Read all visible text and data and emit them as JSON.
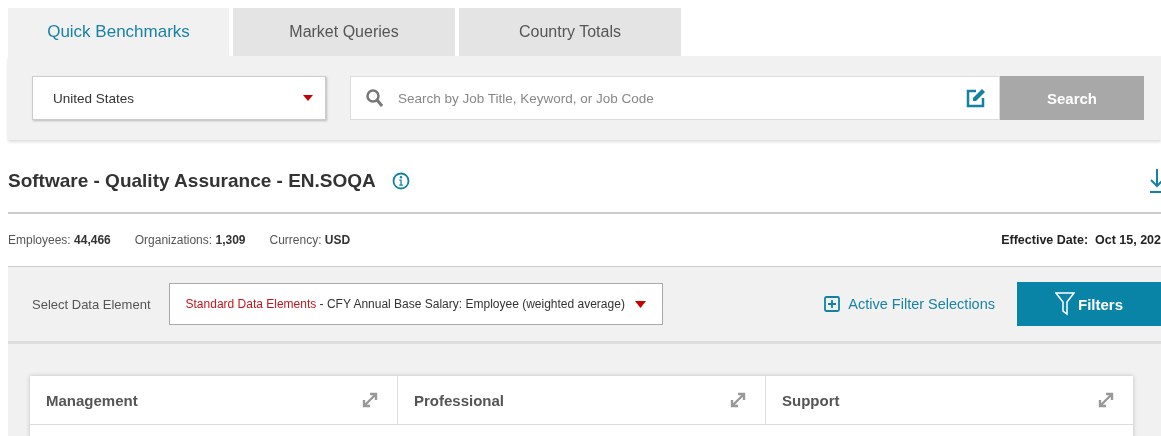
{
  "tabs": [
    {
      "label": "Quick Benchmarks",
      "selected": true
    },
    {
      "label": "Market Queries",
      "selected": false
    },
    {
      "label": "Country Totals",
      "selected": false
    }
  ],
  "country_select": {
    "value": "United States"
  },
  "search": {
    "placeholder": "Search by Job Title, Keyword, or Job Code",
    "button": "Search",
    "disabled": true
  },
  "job": {
    "title": "Software - Quality Assurance - EN.SOQA"
  },
  "stats": [
    {
      "label": "Employees:",
      "value": "44,466"
    },
    {
      "label": "Organizations:",
      "value": "1,309"
    },
    {
      "label": "Currency:",
      "value": "USD"
    }
  ],
  "effective_date": {
    "label": "Effective Date:",
    "value": "Oct 15, 202"
  },
  "data_element": {
    "label": "Select Data Element",
    "category": "Standard Data Elements",
    "value": "- CFY Annual Base Salary: Employee (weighted average)"
  },
  "active_filters": {
    "label": "Active Filter Selections"
  },
  "filters_button": {
    "label": "Filters"
  },
  "cards": [
    {
      "title": "Management"
    },
    {
      "title": "Professional"
    },
    {
      "title": "Support"
    }
  ]
}
